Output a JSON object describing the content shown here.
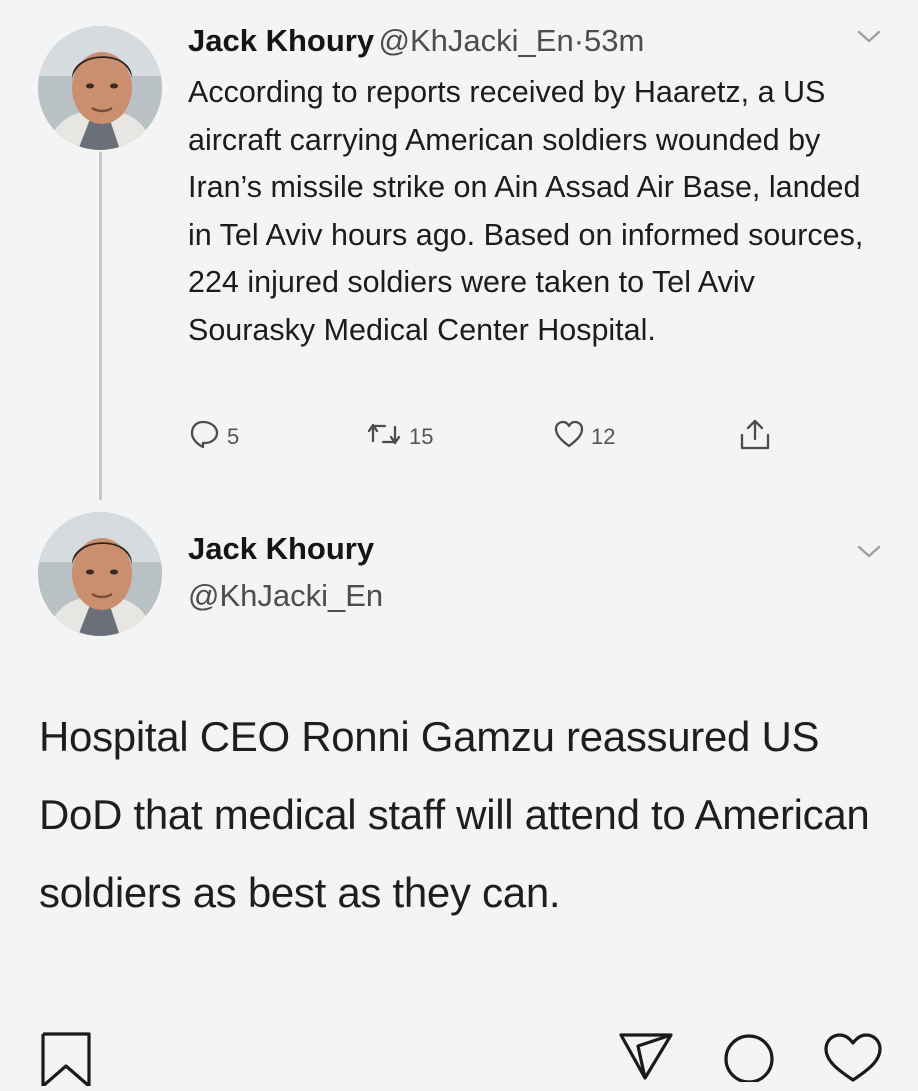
{
  "tweet": {
    "author_name": "Jack Khoury",
    "author_handle": "@KhJacki_En",
    "separator": "·",
    "time": "53m",
    "text": "According to reports received by Haaretz, a US aircraft carrying American soldiers wounded by Iran’s missile strike on Ain Assad Air Base, landed in Tel Aviv hours ago. Based on informed sources, 224 injured soldiers were taken to Tel Aviv Sourasky Medical Center Hospital.",
    "actions": {
      "reply_count": "5",
      "retweet_count": "15",
      "like_count": "12"
    }
  },
  "reply_tweet": {
    "author_name": "Jack Khoury",
    "author_handle": "@KhJacki_En",
    "text": "Hospital CEO Ronni Gamzu reassured US DoD that medical staff will attend to American soldiers as best as they can."
  },
  "icons": {
    "reply": "reply-icon",
    "retweet": "retweet-icon",
    "like": "heart-icon",
    "share": "share-icon",
    "chevron": "chevron-down-icon",
    "bookmark": "bookmark-icon",
    "send": "send-icon",
    "comment": "comment-icon",
    "bottom_like": "heart-icon"
  },
  "colors": {
    "background": "#f4f4f4",
    "text": "#1c1c1c",
    "muted": "#555555",
    "thread_line": "#c7c7c7"
  }
}
